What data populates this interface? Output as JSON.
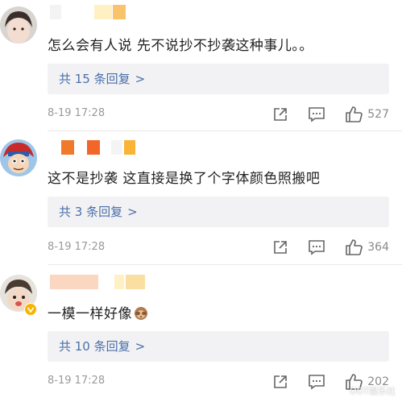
{
  "comments": [
    {
      "text": "怎么会有人说  先不说抄不抄袭这种事儿。。",
      "replies": "共 15 条回复",
      "timestamp": "8-19 17:28",
      "likes": "527"
    },
    {
      "text": "这不是抄袭 这直接是换了个字体颜色照搬吧",
      "replies": "共 3 条回复",
      "timestamp": "8-19 17:28",
      "likes": "364"
    },
    {
      "text": "一模一样好像",
      "replies": "共 10 条回复",
      "timestamp": "8-19 17:28",
      "likes": "202"
    }
  ],
  "ui": {
    "chevron": ">",
    "watermark": "OOT娱乐社"
  },
  "icons": {
    "share": "share-icon",
    "comment": "comment-icon",
    "like": "thumbs-up-icon",
    "emoji": "see-no-evil-monkey-icon"
  },
  "colors": {
    "link": "#4a6fa8",
    "reply_bg": "#f2f2f4",
    "meta": "#9a9a9a",
    "text": "#222222"
  }
}
